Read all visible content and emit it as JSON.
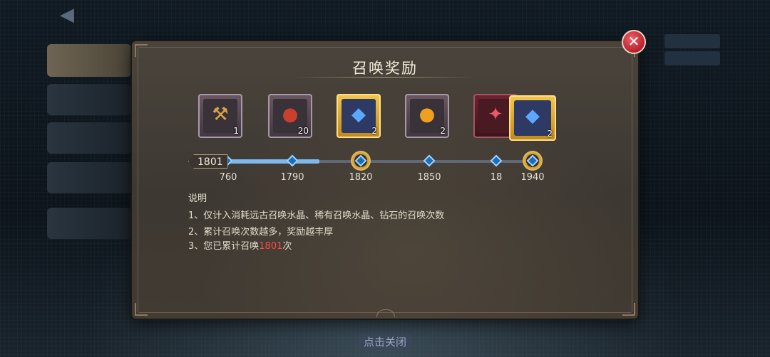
{
  "panel": {
    "title": "召唤奖励",
    "close_icon": "close-x-icon"
  },
  "rewards": {
    "current_count": "1801",
    "items": [
      {
        "icon": "crafting-material-icon",
        "qty": "1",
        "frame": "purple"
      },
      {
        "icon": "meat-food-icon",
        "qty": "20",
        "frame": "purple"
      },
      {
        "icon": "blue-crystal-icon",
        "qty": "2",
        "frame": "gold"
      },
      {
        "icon": "golden-orb-icon",
        "qty": "2",
        "frame": "purple"
      },
      {
        "icon": "red-scroll-icon",
        "qty": "",
        "frame": "red"
      }
    ],
    "milestones": [
      "760",
      "1790",
      "1820",
      "1850",
      "18"
    ],
    "progress_value": 1801,
    "featured": {
      "icon": "blue-crystal-icon",
      "qty": "2",
      "milestone": "1940"
    }
  },
  "description": {
    "heading": "说明",
    "line1": "1、仅计入消耗远古召唤水晶、稀有召唤水晶、钻石的召唤次数",
    "line2": "2、累计召唤次数越多，奖励越丰厚",
    "line3_prefix": "3、您已累计召唤",
    "line3_value": "1801",
    "line3_suffix": "次"
  },
  "footer": {
    "tap_close": "点击关闭"
  },
  "colors": {
    "highlight": "#ff4a4a",
    "progress": "#7fb8ea",
    "gold_frame": "#f2c64a"
  }
}
